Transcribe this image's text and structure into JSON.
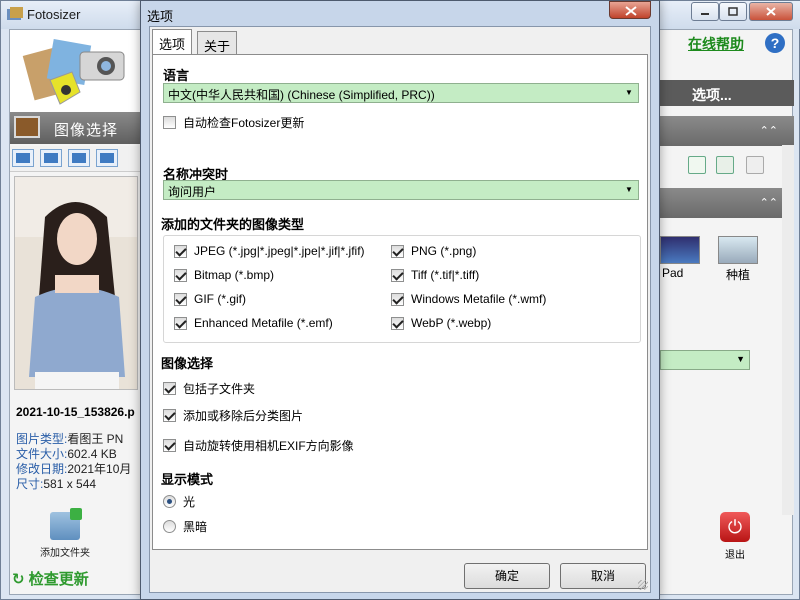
{
  "main_window": {
    "title": "Fotosizer",
    "left_header": "图像选择",
    "online_help": "在线帮助",
    "options_label": "选项...",
    "image_info": {
      "filename": "2021-10-15_153826.p",
      "rows": [
        {
          "key": "图片类型:",
          "value": "看图王 PN"
        },
        {
          "key": "文件大小:",
          "value": "602.4 KB"
        },
        {
          "key": "修改日期:",
          "value": "2021年10月"
        },
        {
          "key": "尺寸:",
          "value": "581 x 544"
        }
      ]
    },
    "add_folder": "添加文件夹",
    "check_update": "检查更新",
    "exit": "退出",
    "thumb_labels": [
      "Pad",
      "种植"
    ]
  },
  "dialog": {
    "title": "选项",
    "tabs": [
      "选项",
      "关于"
    ],
    "language": {
      "title": "语言",
      "value": "中文(中华人民共和国) (Chinese (Simplified, PRC))",
      "auto_update_label": "自动检查Fotosizer更新",
      "auto_update_checked": false
    },
    "name_conflict": {
      "title": "名称冲突时",
      "value": "询问用户"
    },
    "image_types": {
      "title": "添加的文件夹的图像类型",
      "left": [
        {
          "label": "JPEG (*.jpg|*.jpeg|*.jpe|*.jif|*.jfif)",
          "checked": true
        },
        {
          "label": "Bitmap (*.bmp)",
          "checked": true
        },
        {
          "label": "GIF (*.gif)",
          "checked": true
        },
        {
          "label": "Enhanced Metafile (*.emf)",
          "checked": true
        }
      ],
      "right": [
        {
          "label": "PNG (*.png)",
          "checked": true
        },
        {
          "label": "Tiff (*.tif|*.tiff)",
          "checked": true
        },
        {
          "label": "Windows Metafile (*.wmf)",
          "checked": true
        },
        {
          "label": "WebP (*.webp)",
          "checked": true
        }
      ]
    },
    "image_selection": {
      "title": "图像选择",
      "items": [
        {
          "label": "包括子文件夹",
          "checked": true
        },
        {
          "label": "添加或移除后分类图片",
          "checked": true
        },
        {
          "label": "自动旋转使用相机EXIF方向影像",
          "checked": true
        }
      ]
    },
    "display_mode": {
      "title": "显示模式",
      "options": [
        {
          "label": "光",
          "selected": true
        },
        {
          "label": "黑暗",
          "selected": false
        }
      ]
    },
    "ok_label": "确定",
    "cancel_label": "取消"
  }
}
